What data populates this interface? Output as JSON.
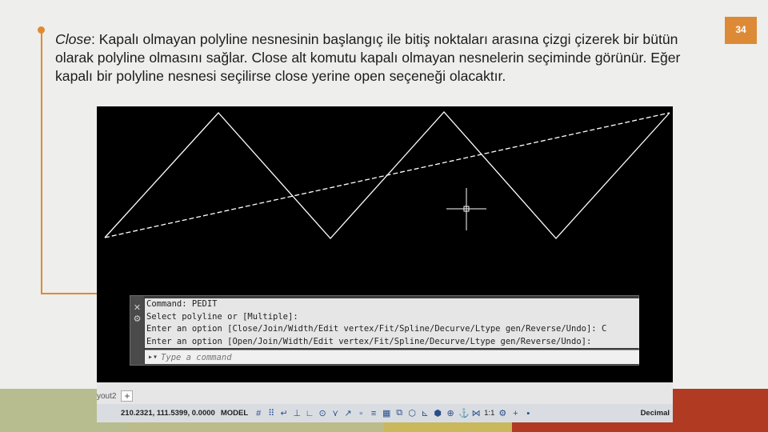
{
  "slide": {
    "page_number": "34",
    "term": "Close",
    "paragraph": ": Kapalı olmayan polyline nesnesinin başlangıç ile bitiş noktaları arasına çizgi çizerek bir bütün olarak polyline olmasını sağlar. Close alt komutu kapalı olmayan nesnelerin seçiminde görünür. Eğer kapalı bir polyline nesnesi seçilirse close yerine open seçeneği olacaktır."
  },
  "command_line": {
    "history": [
      "Command: PEDIT",
      "Select polyline or [Multiple]:",
      "Enter an option [Close/Join/Width/Edit vertex/Fit/Spline/Decurve/Ltype gen/Reverse/Undo]: C",
      "Enter an option [Open/Join/Width/Edit vertex/Fit/Spline/Decurve/Ltype gen/Reverse/Undo]:"
    ],
    "placeholder": "Type a command",
    "close_icon": "close-icon",
    "settings_icon": "wrench-icon"
  },
  "tabs": {
    "layout_tab": "yout2",
    "add_label": "+"
  },
  "status_bar": {
    "coordinates": "210.2321, 111.5399, 0.0000",
    "model": "MODEL",
    "scale": "1:1",
    "units": "Decimal",
    "colors": {
      "icon": "#2a4e8c"
    }
  },
  "colors": {
    "accent": "#dd8a36",
    "canvas_bg": "#000000",
    "polyline": "#ffffff"
  }
}
